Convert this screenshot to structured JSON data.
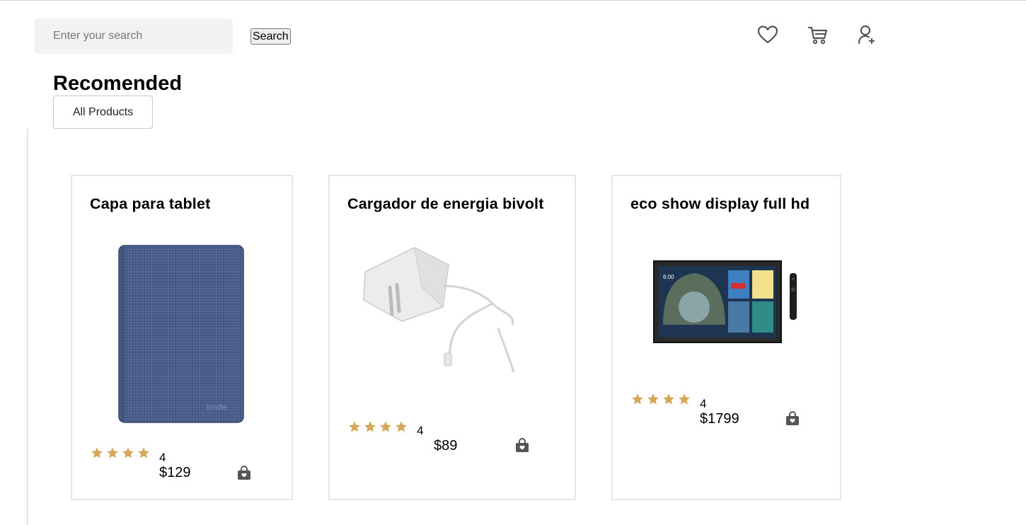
{
  "search": {
    "placeholder": "Enter your search",
    "value": "",
    "button_label": "Search"
  },
  "header_icons": [
    "heart-icon",
    "cart-icon",
    "user-add-icon"
  ],
  "section": {
    "heading": "Recomended",
    "filter_label": "All Products"
  },
  "colors": {
    "star": "#d4a85a",
    "icon": "#555555",
    "card_border": "#e6e6e6"
  },
  "products": [
    {
      "title": "Capa para tablet",
      "rating": "4",
      "price": "$129",
      "image": "blue-fabric-tablet-cover"
    },
    {
      "title": "Cargador de energia bivolt",
      "rating": "4",
      "price": "$89",
      "image": "white-power-adapter"
    },
    {
      "title": "eco show display full hd",
      "rating": "4",
      "price": "$1799",
      "image": "smart-display-with-remote"
    }
  ]
}
